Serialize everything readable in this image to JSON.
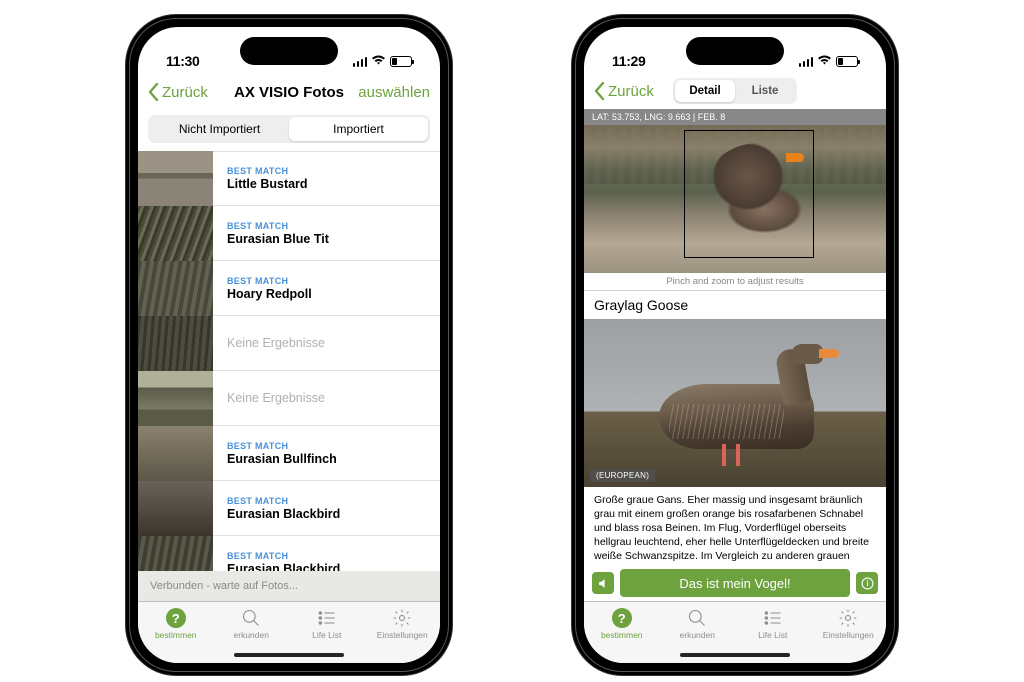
{
  "phone1": {
    "status": {
      "time": "11:30"
    },
    "nav": {
      "back": "Zurück",
      "title": "AX VISIO Fotos",
      "action": "auswählen"
    },
    "segmented": {
      "left": "Nicht Importiert",
      "right": "Importiert"
    },
    "labels": {
      "best_match": "BEST MATCH",
      "no_results": "Keine Ergebnisse"
    },
    "list": [
      {
        "match": true,
        "species": "Little Bustard"
      },
      {
        "match": true,
        "species": "Eurasian Blue Tit"
      },
      {
        "match": true,
        "species": "Hoary Redpoll"
      },
      {
        "match": false
      },
      {
        "match": false
      },
      {
        "match": true,
        "species": "Eurasian Bullfinch"
      },
      {
        "match": true,
        "species": "Eurasian Blackbird"
      },
      {
        "match": true,
        "species": "Eurasian Blackbird"
      }
    ],
    "footer": "Verbunden - warte auf Fotos..."
  },
  "phone2": {
    "status": {
      "time": "11:29"
    },
    "nav": {
      "back": "Zurück",
      "tab_detail": "Detail",
      "tab_list": "Liste"
    },
    "coords": "LAT: 53.753, LNG: 9.663  |  FEB. 8",
    "pinch_hint": "Pinch and zoom to adjust results",
    "species_title": "Graylag Goose",
    "region_tag": "(EUROPEAN)",
    "description": "Große graue Gans. Eher massig und insgesamt bräunlich grau mit einem großen orange bis rosafarbenen Schnabel und blass rosa Beinen. Im Flug, Vorderflügel oberseits hellgrau leuchtend, eher helle Unterflügeldecken und breite weiße Schwanzspitze. Im Vergleich zu anderen grauen Gänsen, sind Details der Schnabelzeichnung und -farbe, Kopf- und Halsmuster sowie Farbe der Unterflügel (dunkler",
    "action_button": "Das ist mein Vogel!"
  },
  "tabs": {
    "bestimmen": "bestimmen",
    "erkunden": "erkunden",
    "lifelist": "Life List",
    "einstellungen": "Einstellungen"
  }
}
